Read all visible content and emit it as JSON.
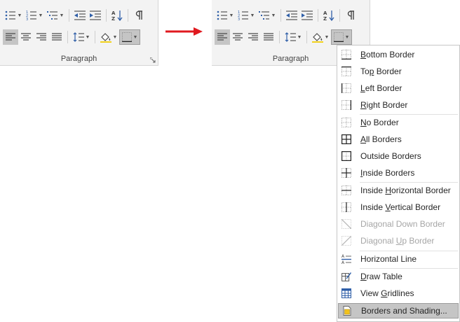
{
  "ribbon": {
    "group_label": "Paragraph",
    "buttons": {
      "bullets": "bullets-icon",
      "numbering": "numbering-icon",
      "multilevel": "multilevel-list-icon",
      "decrease_indent": "decrease-indent-icon",
      "increase_indent": "increase-indent-icon",
      "sort": "sort-icon",
      "show_marks": "pilcrow-icon",
      "align_left": "align-left-icon",
      "center": "align-center-icon",
      "align_right": "align-right-icon",
      "justify": "justify-icon",
      "line_spacing": "line-spacing-icon",
      "shading": "shading-icon",
      "borders": "borders-icon"
    },
    "accent_arrow_color": "#e0191f"
  },
  "borders_menu": {
    "items": [
      {
        "label": "Bottom Border",
        "accel": "B"
      },
      {
        "label": "Top Border",
        "accel": "p"
      },
      {
        "label": "Left Border",
        "accel": "L"
      },
      {
        "label": "Right Border",
        "accel": "R"
      },
      {
        "label": "No Border",
        "accel": "N"
      },
      {
        "label": "All Borders",
        "accel": "A"
      },
      {
        "label": "Outside Borders",
        "accel": "S"
      },
      {
        "label": "Inside Borders",
        "accel": "I"
      },
      {
        "label": "Inside Horizontal Border",
        "accel": "H"
      },
      {
        "label": "Inside Vertical Border",
        "accel": "V"
      },
      {
        "label": "Diagonal Down Border",
        "accel": "W"
      },
      {
        "label": "Diagonal Up Border",
        "accel": "U"
      },
      {
        "label": "Horizontal Line",
        "accel": "Z"
      },
      {
        "label": "Draw Table",
        "accel": "D"
      },
      {
        "label": "View Gridlines",
        "accel": "G"
      },
      {
        "label": "Borders and Shading...",
        "accel": "O"
      }
    ]
  }
}
